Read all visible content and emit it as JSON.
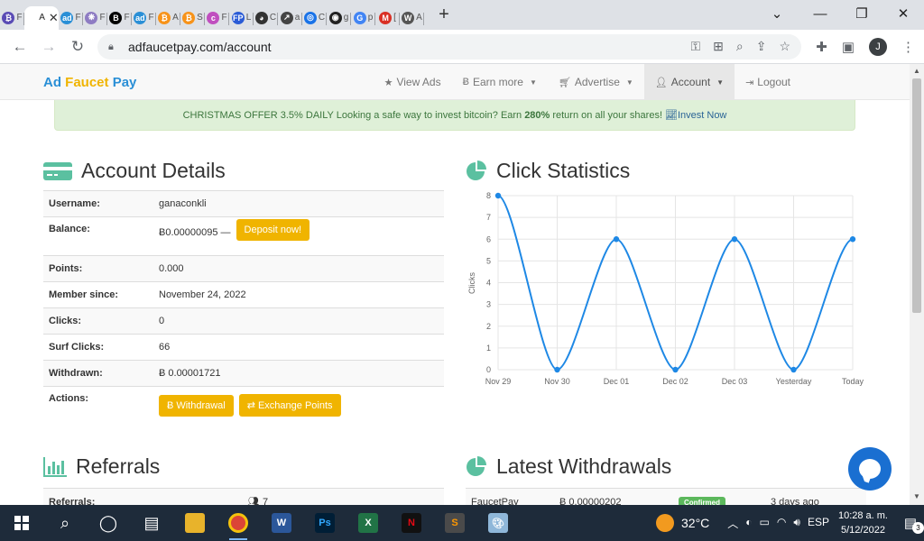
{
  "browser": {
    "tabs": [
      {
        "letter": "F",
        "icon": "bitcoin-multi-icon",
        "color": "#5a4bb5",
        "glyph": "₿"
      },
      {
        "letter": "A",
        "icon": "adfaucetpay-icon",
        "color": "#ffffff",
        "glyph": "",
        "active": true
      },
      {
        "letter": "F",
        "icon": "ad-icon",
        "color": "#2a8fd6",
        "glyph": "ad"
      },
      {
        "letter": "F",
        "icon": "mesh-icon",
        "color": "#8e7cc3",
        "glyph": "❋"
      },
      {
        "letter": "F",
        "icon": "bold-b-icon",
        "color": "#000000",
        "glyph": "B"
      },
      {
        "letter": "F",
        "icon": "ad-icon",
        "color": "#2a8fd6",
        "glyph": "ad"
      },
      {
        "letter": "A",
        "icon": "orange-square-icon",
        "color": "#f7931a",
        "glyph": "₿"
      },
      {
        "letter": "S",
        "icon": "bitcoin-icon",
        "color": "#f7931a",
        "glyph": "₿"
      },
      {
        "letter": "F",
        "icon": "c-icon",
        "color": "#c04fbf",
        "glyph": "c"
      },
      {
        "letter": "L",
        "icon": "fp-icon",
        "color": "#2a5bd6",
        "glyph": "FP"
      },
      {
        "letter": "C",
        "icon": "penguin-icon",
        "color": "#333333",
        "glyph": "◕"
      },
      {
        "letter": "a",
        "icon": "arrow-square-icon",
        "color": "#444444",
        "glyph": "↗"
      },
      {
        "letter": "C",
        "icon": "search-bubble-icon",
        "color": "#1a73e8",
        "glyph": "◎"
      },
      {
        "letter": "g",
        "icon": "github-icon",
        "color": "#222222",
        "glyph": "◉"
      },
      {
        "letter": "p",
        "icon": "google-icon",
        "color": "#4285f4",
        "glyph": "G"
      },
      {
        "letter": "[",
        "icon": "gmail-icon",
        "color": "#d93025",
        "glyph": "M"
      },
      {
        "letter": "A",
        "icon": "wikipedia-icon",
        "color": "#555555",
        "glyph": "W"
      }
    ],
    "new_tab": "+",
    "url": "adfaucetpay.com/account",
    "profile_initial": "J"
  },
  "site": {
    "brand_part1": "Ad",
    "brand_part2": "Faucet",
    "brand_part3": "Pay",
    "nav": {
      "view_ads": "View Ads",
      "earn_more": "Earn more",
      "advertise": "Advertise",
      "account": "Account",
      "logout": "Logout"
    },
    "promo": {
      "text1": "CHRISTMAS OFFER 3.5% DAILY Looking a safe way to invest bitcoin? Earn",
      "bold": "280%",
      "text2": "return on all your shares!",
      "link": "Invest Now"
    },
    "account_title": "Account Details",
    "details": {
      "username_label": "Username:",
      "username": "ganaconkli",
      "balance_label": "Balance:",
      "balance": "Ƀ0.00000095 —",
      "deposit": "Deposit now!",
      "points_label": "Points:",
      "points": "0.000",
      "member_label": "Member since:",
      "member": "November 24, 2022",
      "clicks_label": "Clicks:",
      "clicks": "0",
      "surf_label": "Surf Clicks:",
      "surf": "66",
      "withdrawn_label": "Withdrawn:",
      "withdrawn": "Ƀ 0.00001721",
      "actions_label": "Actions:",
      "withdrawal": "Withdrawal",
      "exchange": "Exchange Points"
    },
    "stats_title": "Click Statistics",
    "referrals_title": "Referrals",
    "referrals_label": "Referrals:",
    "referrals_value": "7",
    "withdrawals_title": "Latest Withdrawals",
    "withdrawal_row": {
      "method": "FaucetPay",
      "amount": "Ƀ 0.00000202",
      "status": "Confirmed",
      "when": "3 days ago"
    }
  },
  "chart_data": {
    "type": "line",
    "categories": [
      "Nov 29",
      "Nov 30",
      "Dec 01",
      "Dec 02",
      "Dec 03",
      "Yesterday",
      "Today"
    ],
    "series": [
      {
        "values": [
          8,
          0,
          6,
          0,
          6,
          0,
          6
        ]
      }
    ],
    "ylabel": "Clicks",
    "ylim": [
      0,
      8
    ],
    "yticks": [
      "0",
      "1",
      "2",
      "3",
      "4",
      "5",
      "6",
      "7",
      "8"
    ],
    "grid": true,
    "line_color": "#1e88e5"
  },
  "taskbar": {
    "temperature": "32°C",
    "language": "ESP",
    "time": "10:28 a. m.",
    "date": "5/12/2022",
    "notifications": "3"
  }
}
